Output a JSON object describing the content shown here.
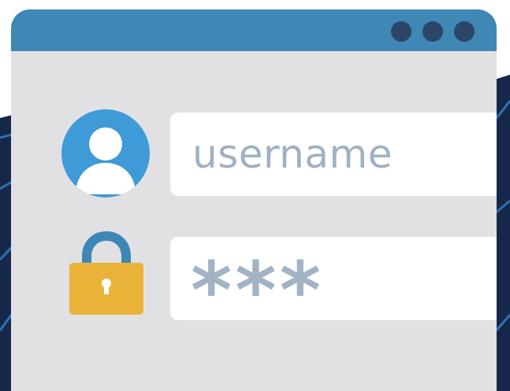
{
  "window": {
    "titlebar_color": "#3f88b6",
    "body_color": "#e1e1e4",
    "controls": [
      {
        "icon": "window-control-dot",
        "color": "#2b4666"
      },
      {
        "icon": "window-control-dot",
        "color": "#2b4666"
      },
      {
        "icon": "window-control-dot",
        "color": "#2b4666"
      }
    ]
  },
  "username_field": {
    "icon": "user-avatar-icon",
    "icon_color": "#3f9ad8",
    "value": "username"
  },
  "password_field": {
    "icon": "padlock-icon",
    "shackle_color": "#3d87b5",
    "body_color": "#e9b33a",
    "value": "***"
  },
  "background": {
    "color": "#16284a",
    "accent": "#2f72b0"
  }
}
